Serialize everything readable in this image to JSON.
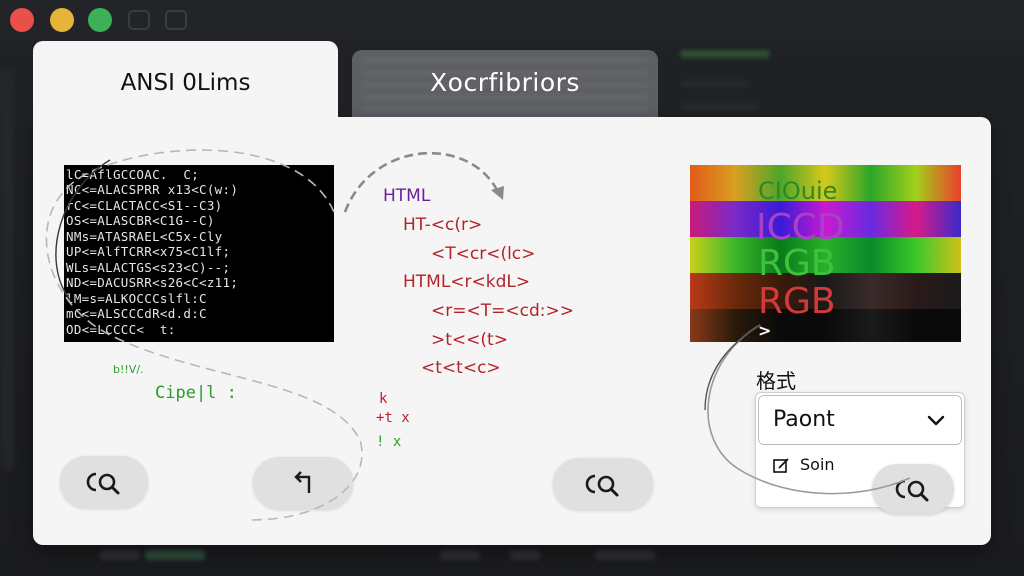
{
  "tabs": [
    {
      "label": "ANSI 0Lims",
      "active": true
    },
    {
      "label": "Xocrfibriors",
      "active": false
    }
  ],
  "terminal": {
    "lines": [
      "lC=AflGCCOAC.  C;",
      "NC<=ALACSPRR x13<C(w:)",
      "rC<=CLACTACC<S1--C3)",
      "OS<=ALASCBR<C1G--C)",
      "NMs=ATASRAEL<C5x-Cly",
      "UP<=AlfTCRR<x75<C1lf;",
      "WLs=ALACTGS<s23<C)--;",
      "ND<=DACUSRR<s26<C<z11;",
      "lM=s=ALKOCCCslfl:C",
      "mC<=ALSCCCdR<d.d:C",
      "OD<=LCCCC<  t:"
    ]
  },
  "green_small": "b!!V/.",
  "green_code": "Cipe|l :",
  "code_snippet": {
    "lines": [
      "HTML",
      "HT-<c(r>",
      "<T<cr<(lc>",
      "HTML<r<kdL>",
      "<r=<T=<cd:>>",
      ">t<<(t>",
      "<t<t<c>"
    ],
    "extra": [
      "k",
      "+t  x",
      "!  x"
    ]
  },
  "swatch": {
    "lines": [
      "CIOuie",
      "ICCD",
      "RGB",
      "RGB",
      ">"
    ],
    "colors": [
      "#2a8a2a",
      "#a840c8",
      "#3ec23e",
      "#d23a3a"
    ]
  },
  "format": {
    "label": "格式",
    "selected": "Paont",
    "menu_items": [
      "Soin"
    ]
  }
}
